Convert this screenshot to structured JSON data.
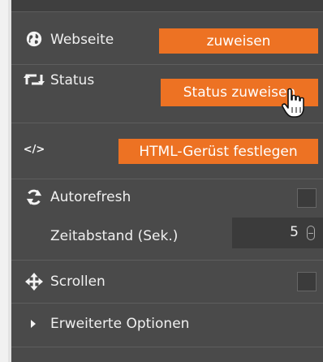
{
  "rows": {
    "webseite": {
      "icon": "globe-icon",
      "label": "Webseite",
      "button": "zuweisen"
    },
    "status": {
      "icon": "retweet-icon",
      "label": "Status",
      "button": "Status zuweisen"
    },
    "html": {
      "icon": "code-icon",
      "icon_text": "</>",
      "button": "HTML-Gerüst festlegen"
    },
    "autorefresh": {
      "icon": "refresh-icon",
      "label": "Autorefresh",
      "checked": false
    },
    "interval": {
      "label": "Zeitabstand (Sek.)",
      "value": "5"
    },
    "scroll": {
      "icon": "move-arrows-icon",
      "label": "Scrollen",
      "checked": false
    },
    "advanced": {
      "icon": "caret-right-icon",
      "label": "Erweiterte Optionen"
    }
  },
  "colors": {
    "panel": "#4a4a4a",
    "accent": "#ed7223",
    "text": "#f0f0f0",
    "input": "#3b3b3b"
  }
}
